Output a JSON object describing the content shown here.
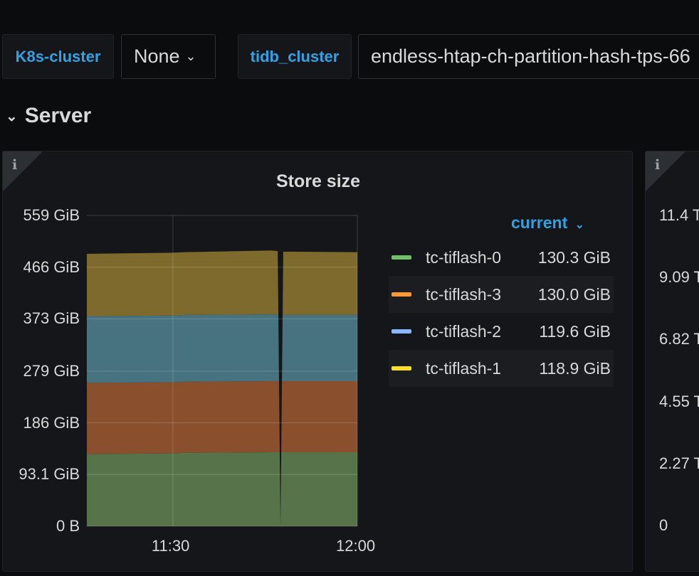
{
  "variables": {
    "k8s_label": "K8s-cluster",
    "k8s_value": "None",
    "tidb_label": "tidb_cluster",
    "tidb_value": "endless-htap-ch-partition-hash-tps-66"
  },
  "row": {
    "title": "Server"
  },
  "panel": {
    "info_icon": "i",
    "title": "Store size",
    "legend_header": "current",
    "legend": [
      {
        "name": "tc-tiflash-0",
        "value": "130.3 GiB",
        "color": "#73bf69"
      },
      {
        "name": "tc-tiflash-3",
        "value": "130.0 GiB",
        "color": "#ff9830"
      },
      {
        "name": "tc-tiflash-2",
        "value": "119.6 GiB",
        "color": "#8ab8ff"
      },
      {
        "name": "tc-tiflash-1",
        "value": "118.9 GiB",
        "color": "#fade2a"
      }
    ]
  },
  "second_panel": {
    "info_icon": "i",
    "yticks": [
      "11.4 T",
      "9.09 T",
      "6.82 T",
      "4.55 T",
      "2.27 T",
      "0"
    ]
  },
  "chart_data": {
    "type": "area",
    "stacked": true,
    "title": "Store size",
    "ylabel": "",
    "ylim": [
      0,
      559
    ],
    "yticks": [
      "0 B",
      "93.1 GiB",
      "186 GiB",
      "279 GiB",
      "373 GiB",
      "466 GiB",
      "559 GiB"
    ],
    "ytick_values": [
      0,
      93.1,
      186,
      279,
      373,
      466,
      559
    ],
    "xticks": [
      "11:30",
      "12:00"
    ],
    "x_minutes": [
      0,
      14,
      16,
      30,
      32,
      44
    ],
    "xtick_minutes": [
      14,
      44
    ],
    "gap_minute": 31.5,
    "series": [
      {
        "name": "tc-tiflash-0",
        "color": "#56734a",
        "values": [
          130,
          131,
          132,
          133,
          133,
          133
        ]
      },
      {
        "name": "tc-tiflash-3",
        "color": "#8a4f2d",
        "values": [
          128,
          128,
          128,
          128,
          128,
          128
        ]
      },
      {
        "name": "tc-tiflash-2",
        "color": "#46737f",
        "values": [
          120,
          120,
          120,
          120,
          119,
          119
        ]
      },
      {
        "name": "tc-tiflash-1",
        "color": "#7d6a2c",
        "values": [
          112,
          113,
          113,
          115,
          114,
          113
        ]
      }
    ],
    "grid": true,
    "legend": "right"
  }
}
